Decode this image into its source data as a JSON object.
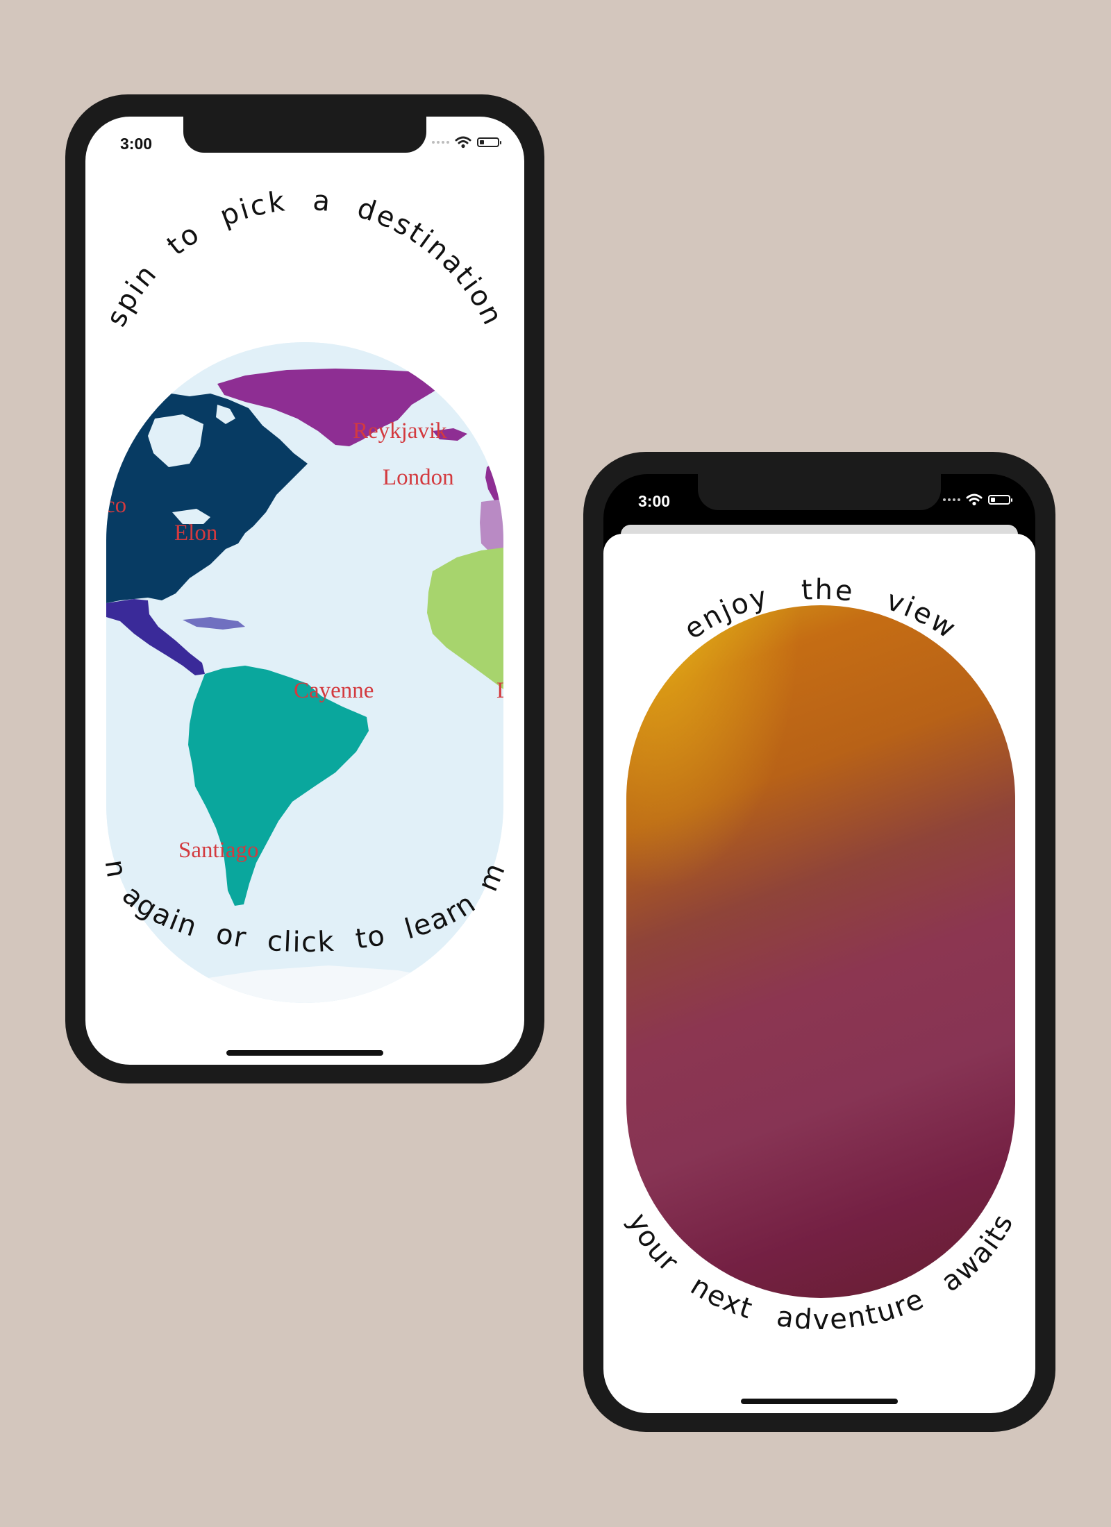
{
  "phones": [
    {
      "status": {
        "time": "3:00"
      },
      "header_text": "spin to pick a destination",
      "footer_text": "spin again or click to learn more",
      "map_labels": {
        "reykjavik": "Reykjavik",
        "london": "London",
        "elon": "Elon",
        "cayenne": "Cayenne",
        "santiago": "Santiago",
        "co_partial": "co",
        "l_partial": "L"
      }
    },
    {
      "status": {
        "time": "3:00"
      },
      "header_text": "enjoy the view",
      "footer_text": "your next adventure awaits"
    }
  ],
  "colors": {
    "background": "#d3c6bd",
    "phone_frame": "#1b1b1b",
    "ocean": "#e1f0f8",
    "north_america": "#073b63",
    "greenland": "#8e2e93",
    "central_america": "#3a2a99",
    "south_america": "#0aa79d",
    "africa": "#a7d46d",
    "city_label": "#d33a3f"
  },
  "icons": [
    "wifi-icon",
    "battery-icon",
    "cellular-signal-icon"
  ]
}
